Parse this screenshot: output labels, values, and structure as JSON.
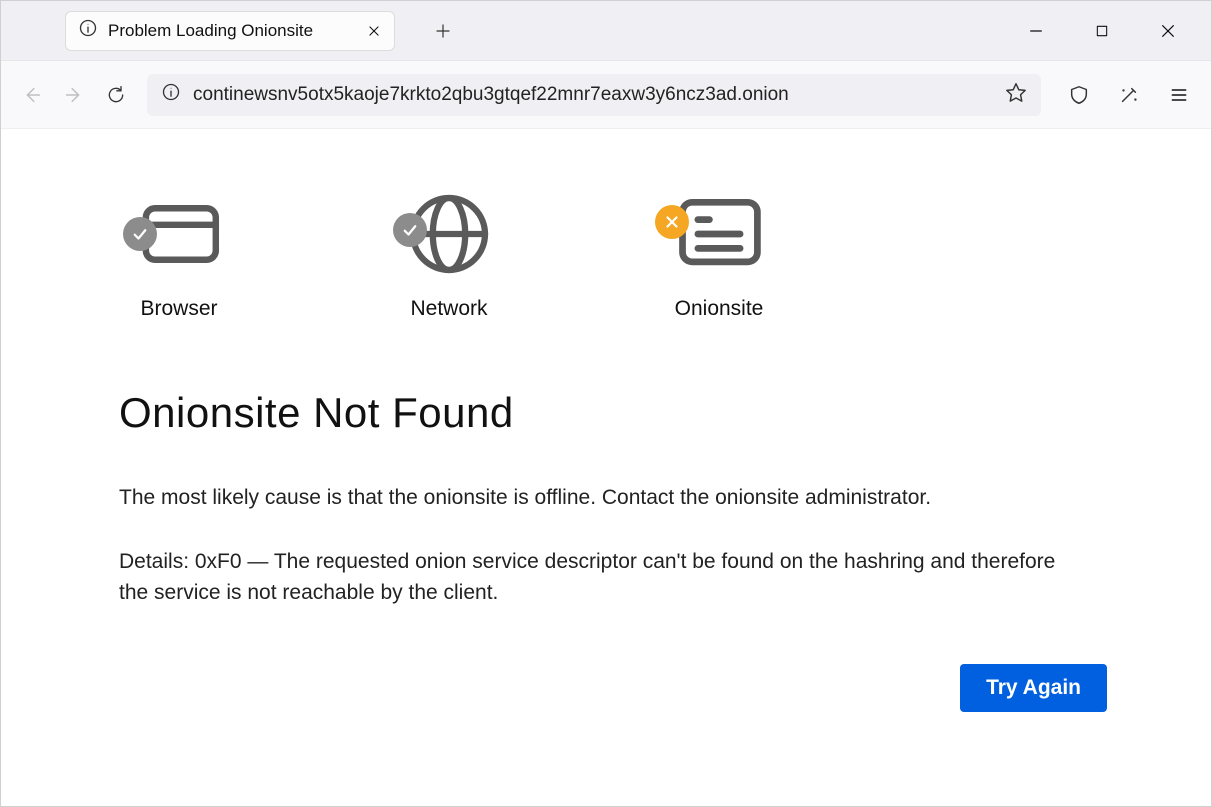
{
  "tab": {
    "title": "Problem Loading Onionsite"
  },
  "url": {
    "text": "continewsnv5otx5kaoje7krkto2qbu3gtqef22mnr7eaxw3y6ncz3ad.onion"
  },
  "status": {
    "browser": "Browser",
    "network": "Network",
    "onionsite": "Onionsite"
  },
  "error": {
    "heading": "Onionsite Not Found",
    "description": "The most likely cause is that the onionsite is offline. Contact the onionsite administrator.",
    "details": "Details: 0xF0 — The requested onion service descriptor can't be found on the hashring and therefore the service is not reachable by the client.",
    "button": "Try Again"
  }
}
